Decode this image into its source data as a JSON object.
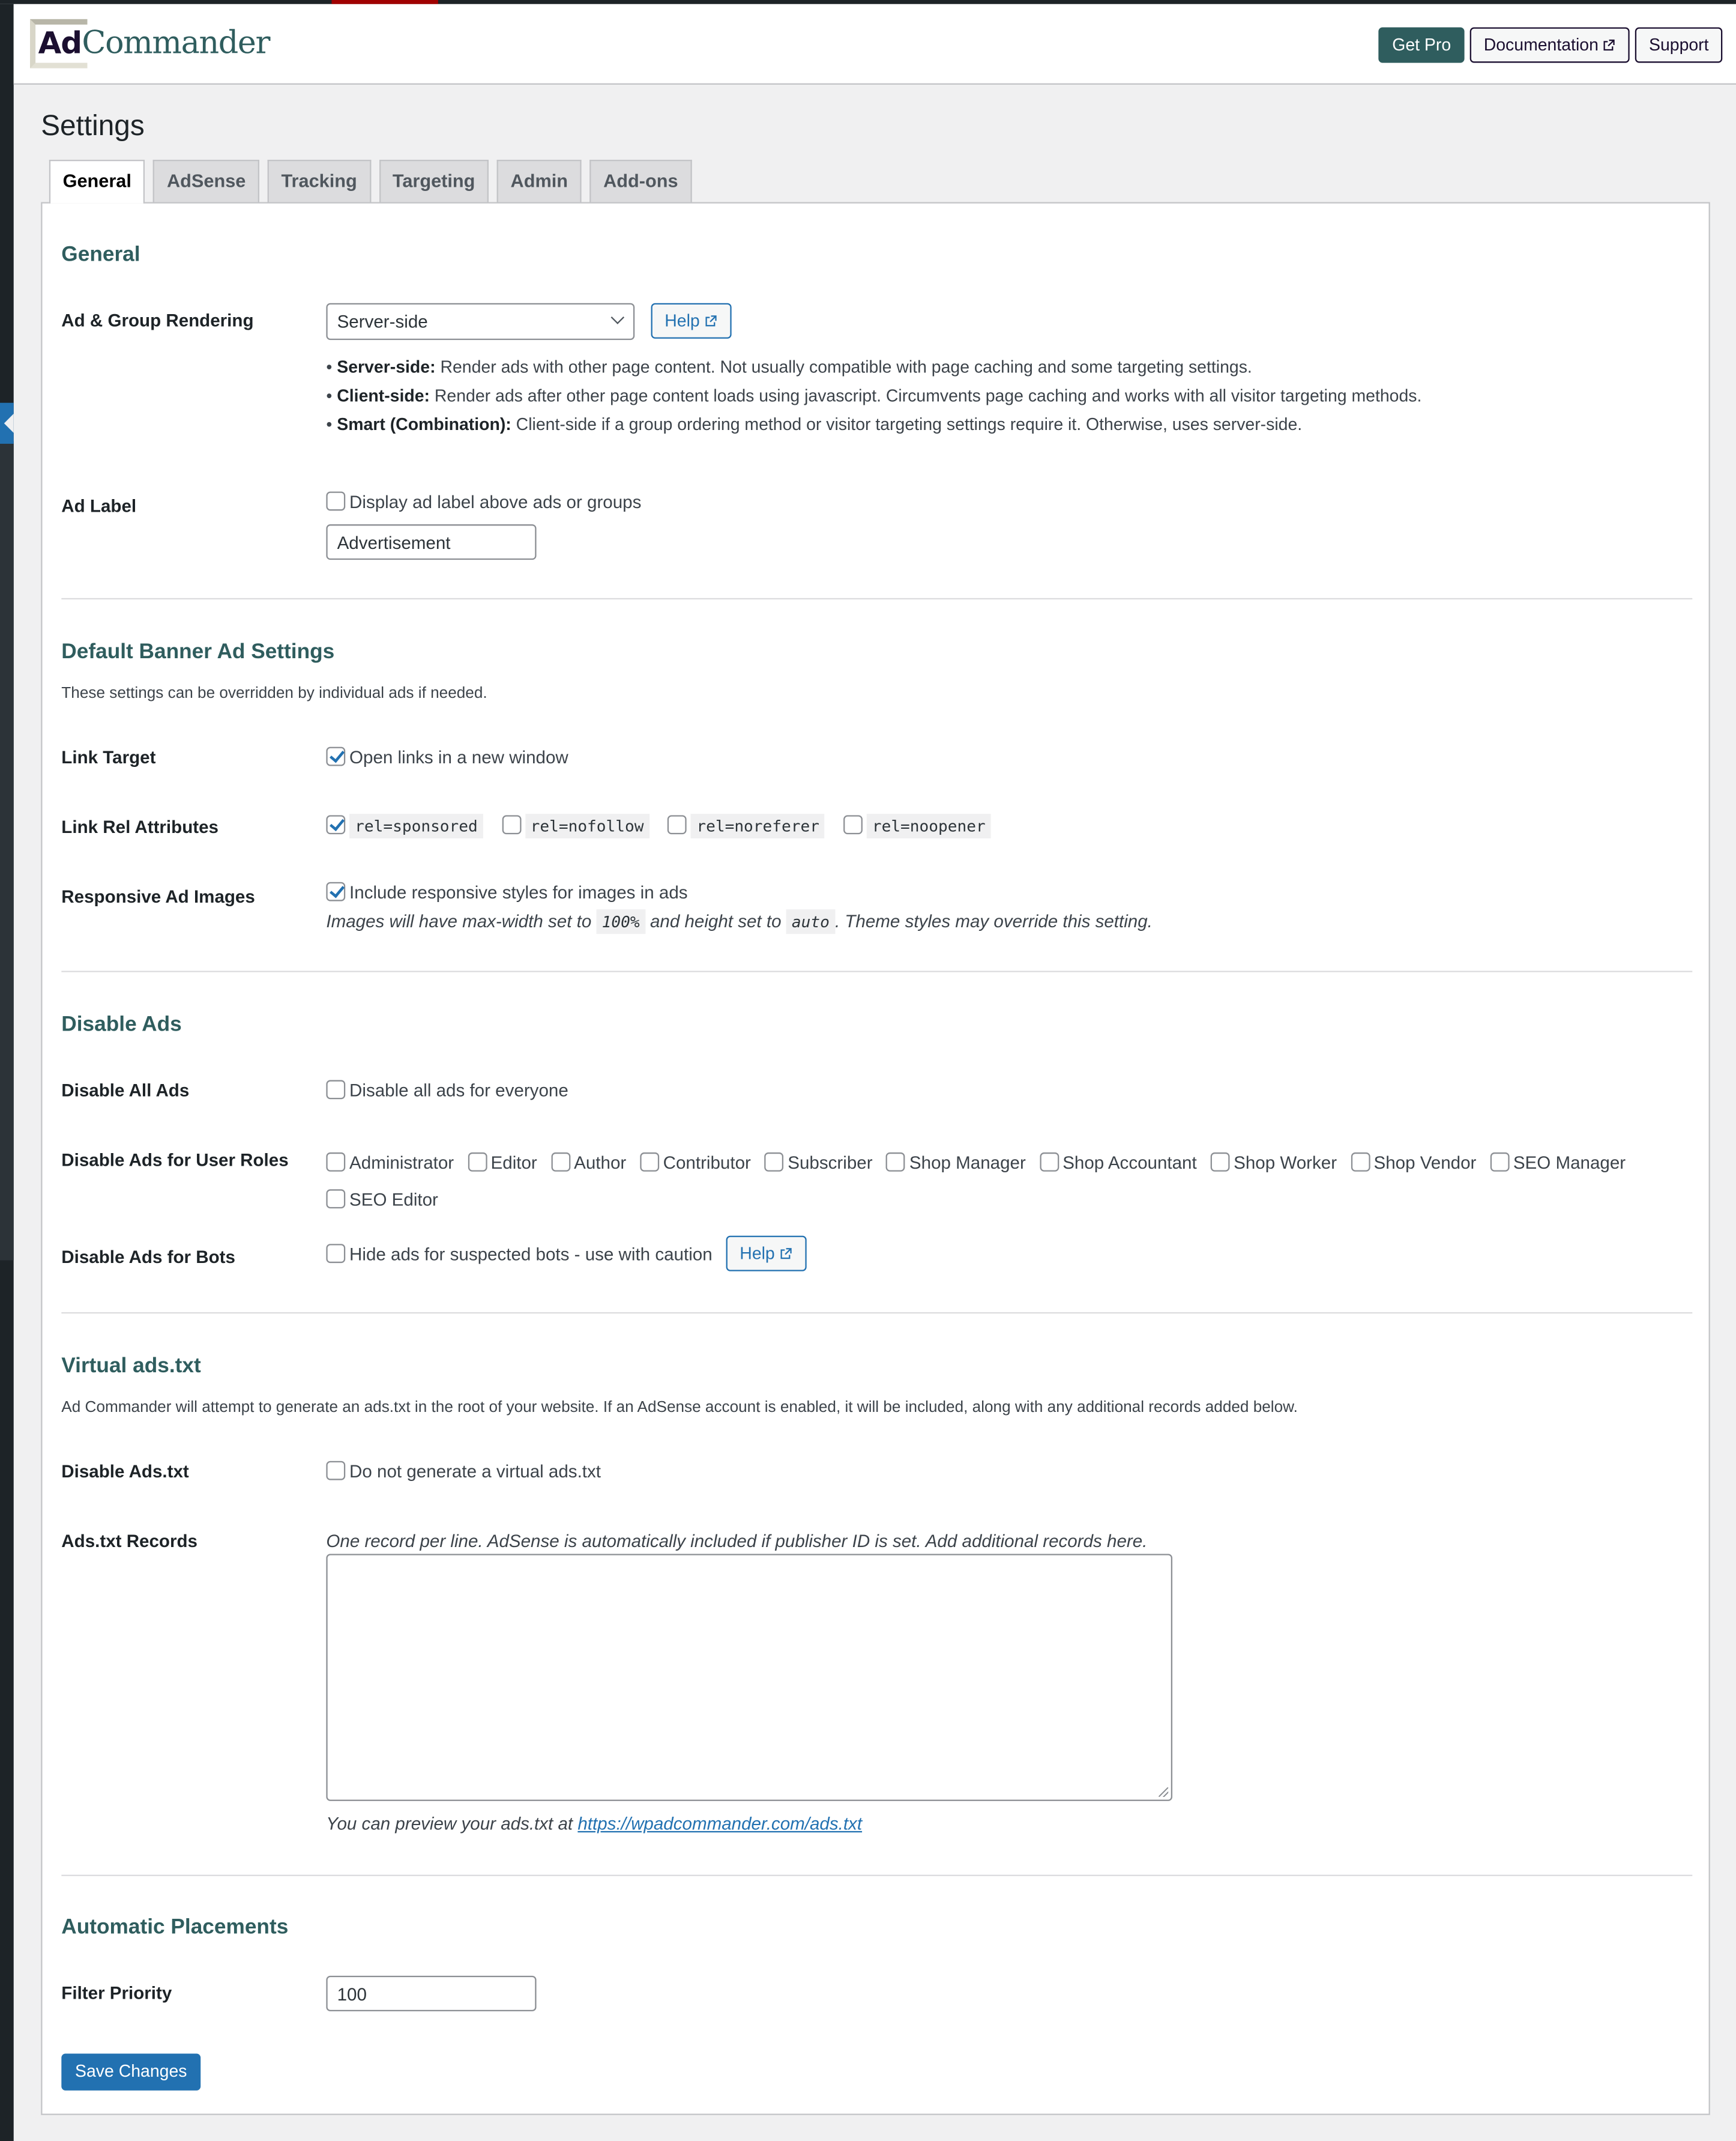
{
  "header": {
    "logo_ad": "Ad",
    "logo_commander": "Commander",
    "buttons": {
      "get_pro": "Get Pro",
      "documentation": "Documentation",
      "support": "Support"
    }
  },
  "page": {
    "title": "Settings"
  },
  "tabs": [
    {
      "label": "General",
      "active": true
    },
    {
      "label": "AdSense",
      "active": false
    },
    {
      "label": "Tracking",
      "active": false
    },
    {
      "label": "Targeting",
      "active": false
    },
    {
      "label": "Admin",
      "active": false
    },
    {
      "label": "Add-ons",
      "active": false
    }
  ],
  "general": {
    "title": "General",
    "rendering": {
      "label": "Ad & Group Rendering",
      "selected": "Server-side",
      "help": "Help",
      "bullets": [
        {
          "term": "Server-side:",
          "text": " Render ads with other page content. Not usually compatible with page caching and some targeting settings."
        },
        {
          "term": "Client-side:",
          "text": " Render ads after other page content loads using javascript. Circumvents page caching and works with all visitor targeting methods."
        },
        {
          "term": "Smart (Combination):",
          "text": " Client-side if a group ordering method or visitor targeting settings require it. Otherwise, uses server-side."
        }
      ]
    },
    "ad_label": {
      "label": "Ad Label",
      "checkbox": "Display ad label above ads or groups",
      "checked": false,
      "value": "Advertisement"
    }
  },
  "banner": {
    "title": "Default Banner Ad Settings",
    "description": "These settings can be overridden by individual ads if needed.",
    "link_target": {
      "label": "Link Target",
      "checkbox": "Open links in a new window",
      "checked": true
    },
    "link_rel": {
      "label": "Link Rel Attributes",
      "options": [
        {
          "code": "rel=sponsored",
          "checked": true
        },
        {
          "code": "rel=nofollow",
          "checked": false
        },
        {
          "code": "rel=noreferer",
          "checked": false
        },
        {
          "code": "rel=noopener",
          "checked": false
        }
      ]
    },
    "responsive": {
      "label": "Responsive Ad Images",
      "checkbox": "Include responsive styles for images in ads",
      "checked": true,
      "note_1": "Images will have max-width set to",
      "code_1": "100%",
      "note_2": "and height set to",
      "code_2": "auto",
      "note_3": ". Theme styles may override this setting."
    }
  },
  "disable": {
    "title": "Disable Ads",
    "all": {
      "label": "Disable All Ads",
      "checkbox": "Disable all ads for everyone",
      "checked": false
    },
    "roles": {
      "label": "Disable Ads for User Roles",
      "options": [
        "Administrator",
        "Editor",
        "Author",
        "Contributor",
        "Subscriber",
        "Shop Manager",
        "Shop Accountant",
        "Shop Worker",
        "Shop Vendor",
        "SEO Manager",
        "SEO Editor"
      ]
    },
    "bots": {
      "label": "Disable Ads for Bots",
      "checkbox": "Hide ads for suspected bots - use with caution",
      "checked": false,
      "help": "Help"
    }
  },
  "adstxt": {
    "title": "Virtual ads.txt",
    "description": "Ad Commander will attempt to generate an ads.txt in the root of your website. If an AdSense account is enabled, it will be included, along with any additional records added below.",
    "disable": {
      "label": "Disable Ads.txt",
      "checkbox": "Do not generate a virtual ads.txt",
      "checked": false
    },
    "records": {
      "label": "Ads.txt Records",
      "hint": "One record per line. AdSense is automatically included if publisher ID is set. Add additional records here.",
      "value": "",
      "preview_text": "You can preview your ads.txt at ",
      "preview_link": "https://wpadcommander.com/ads.txt"
    }
  },
  "placements": {
    "title": "Automatic Placements",
    "filter_priority": {
      "label": "Filter Priority",
      "value": "100"
    }
  },
  "save_label": "Save Changes",
  "colors": {
    "brand_teal": "#2f5d5e",
    "brand_dark": "#1b0f30",
    "wp_blue": "#2271b1"
  }
}
